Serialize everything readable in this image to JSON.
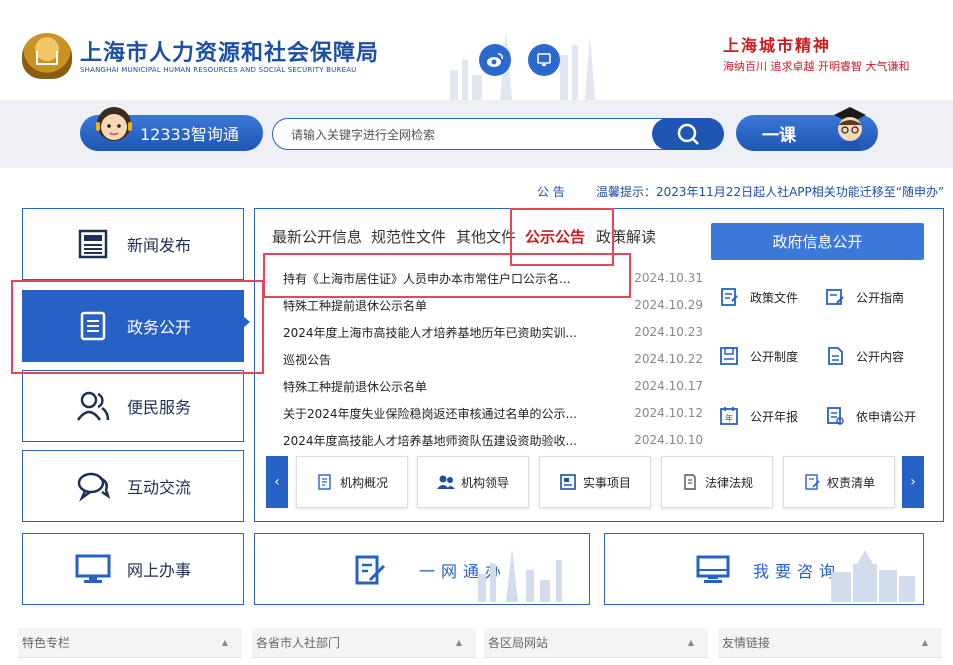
{
  "header": {
    "title": "上海市人力资源和社会保障局",
    "subtitle": "SHANGHAI MUNICIPAL HUMAN RESOURCES AND SOCIAL SECURITY BUREAU",
    "spirit_title": "上海城市精神",
    "spirit_text": "海纳百川 追求卓越 开明睿智 大气谦和",
    "social_icons": [
      "weibo-icon",
      "mobile-icon"
    ]
  },
  "search": {
    "zhixuntong_label": "12333智询通",
    "placeholder": "请输入关键字进行全网检索",
    "yike_label": "一课"
  },
  "notice": {
    "label": "公  告",
    "text": "温馨提示：2023年11月22日起人社APP相关功能迁移至“随申办”"
  },
  "left_nav": [
    {
      "label": "新闻发布",
      "icon": "newspaper-icon"
    },
    {
      "label": "政务公开",
      "icon": "document-icon",
      "active": true
    },
    {
      "label": "便民服务",
      "icon": "people-icon"
    },
    {
      "label": "互动交流",
      "icon": "chat-icon"
    },
    {
      "label": "网上办事",
      "icon": "monitor-icon"
    }
  ],
  "tabs": [
    {
      "label": "最新公开信息"
    },
    {
      "label": "规范性文件"
    },
    {
      "label": "其他文件"
    },
    {
      "label": "公示公告",
      "active": true
    },
    {
      "label": "政策解读"
    }
  ],
  "news": [
    {
      "title": "持有《上海市居住证》人员申办本市常住户口公示名...",
      "date": "2024.10.31"
    },
    {
      "title": "特殊工种提前退休公示名单",
      "date": "2024.10.29"
    },
    {
      "title": "2024年度上海市高技能人才培养基地历年已资助实训...",
      "date": "2024.10.23"
    },
    {
      "title": "巡视公告",
      "date": "2024.10.22"
    },
    {
      "title": "特殊工种提前退休公示名单",
      "date": "2024.10.17"
    },
    {
      "title": "关于2024年度失业保险稳岗返还审核通过名单的公示...",
      "date": "2024.10.12"
    },
    {
      "title": "2024年度高技能人才培养基地师资队伍建设资助验收...",
      "date": "2024.10.10"
    }
  ],
  "gov_info": {
    "title": "政府信息公开",
    "links": [
      {
        "label": "政策文件",
        "icon": "policy-doc-icon"
      },
      {
        "label": "公开指南",
        "icon": "guide-icon"
      },
      {
        "label": "公开制度",
        "icon": "system-icon"
      },
      {
        "label": "公开内容",
        "icon": "content-icon"
      },
      {
        "label": "公开年报",
        "icon": "annual-report-icon"
      },
      {
        "label": "依申请公开",
        "icon": "application-icon"
      }
    ]
  },
  "shortcuts": [
    {
      "label": "机构概况",
      "icon": "org-overview-icon"
    },
    {
      "label": "机构领导",
      "icon": "leaders-icon"
    },
    {
      "label": "实事项目",
      "icon": "projects-icon"
    },
    {
      "label": "法律法规",
      "icon": "law-icon"
    },
    {
      "label": "权责清单",
      "icon": "responsibility-list-icon"
    }
  ],
  "banners": {
    "online": "一网通办",
    "consult": "我要咨询"
  },
  "footer": [
    {
      "label": "特色专栏"
    },
    {
      "label": "各省市人社部门"
    },
    {
      "label": "各区局网站"
    },
    {
      "label": "友情链接"
    }
  ],
  "colors": {
    "primary": "#2661c6",
    "brand_blue": "#1d4fa3",
    "accent_red": "#c61d23",
    "highlight": "#e5465a"
  }
}
